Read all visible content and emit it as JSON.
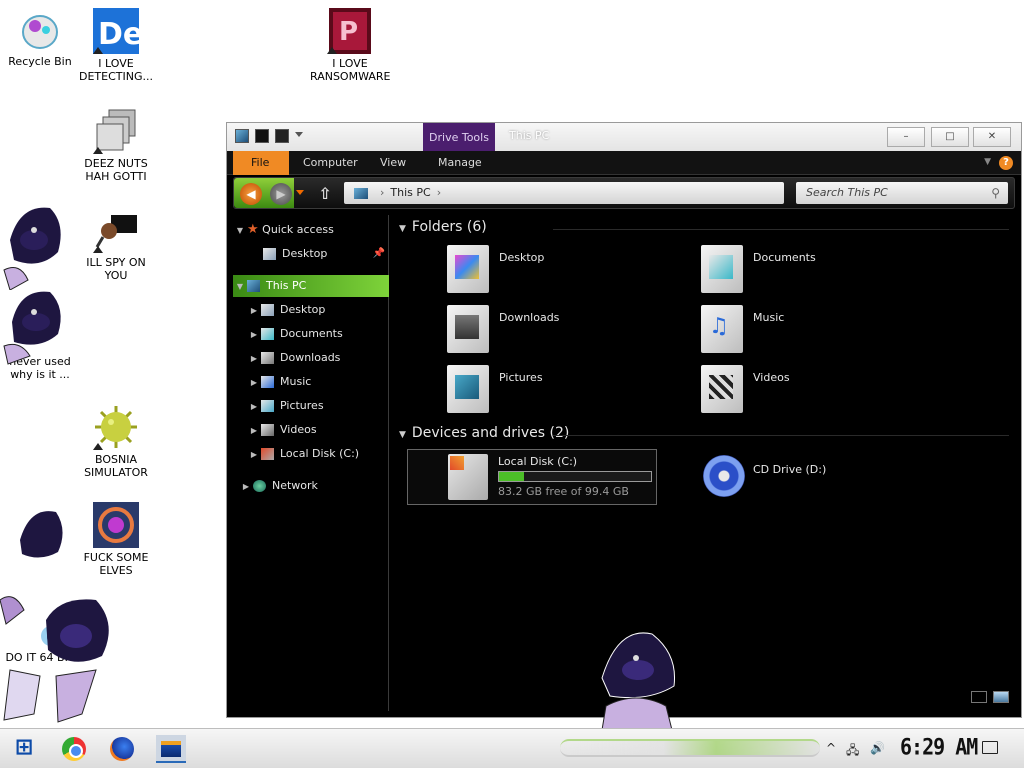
{
  "desktop": {
    "icons": [
      {
        "label": "Recycle Bin"
      },
      {
        "label": "I LOVE\nDETECTING..."
      },
      {
        "label": "I LOVE\nRANSOMWARE"
      },
      {
        "label": "DEEZ NUTS\nHAH GOTTI"
      },
      {
        "label": "ILL SPY ON\nYOU"
      },
      {
        "label": "never used\nwhy is it ..."
      },
      {
        "label": "BOSNIA\nSIMULATOR"
      },
      {
        "label": "FUCK SOME\nELVES"
      },
      {
        "label": "DO IT 64 BIT"
      }
    ]
  },
  "window": {
    "title": "This PC",
    "contextual_tab": "Drive Tools",
    "controls": {
      "minimize": "–",
      "maximize": "□",
      "close": "✕"
    },
    "ribbon_tabs": [
      "File",
      "Computer",
      "View",
      "Manage"
    ],
    "help": "?",
    "address": {
      "path": "This PC"
    },
    "search": {
      "placeholder": "Search This PC"
    },
    "nav": {
      "quick_access": "Quick access",
      "quick_items": [
        "Desktop"
      ],
      "this_pc": "This PC",
      "pc_items": [
        "Desktop",
        "Documents",
        "Downloads",
        "Music",
        "Pictures",
        "Videos",
        "Local Disk (C:)"
      ],
      "network": "Network"
    },
    "folders_header": "Folders (6)",
    "folders": [
      "Desktop",
      "Documents",
      "Downloads",
      "Music",
      "Pictures",
      "Videos"
    ],
    "drives_header": "Devices and drives (2)",
    "drives": [
      {
        "name": "Local Disk (C:)",
        "free": "83.2 GB free of 99.4 GB",
        "used_fraction": 0.163
      },
      {
        "name": "CD Drive (D:)"
      }
    ]
  },
  "taskbar": {
    "clock": "6:29 AM"
  },
  "colors": {
    "accent_orange": "#f08a24",
    "accent_green": "#7ed33a",
    "drive_tools_purple": "#4b1e6e"
  }
}
